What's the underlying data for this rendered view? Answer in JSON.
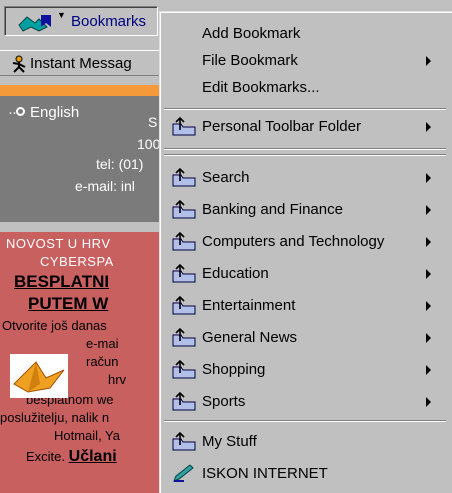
{
  "toolbar": {
    "bookmarks_label": "Bookmarks",
    "instant_messenger_label": "Instant Messag"
  },
  "page": {
    "language_label": "English",
    "contact": {
      "s_fragment": "S",
      "num_fragment": "100",
      "tel": "tel: (01)",
      "email": "e-mail: inl"
    },
    "promo": {
      "line1": "NOVOST U HRV",
      "line2": "CYBERSPA",
      "line3": "BESPLATNI",
      "line4": "PUTEM W",
      "line5": "Otvorite još danas",
      "line6": "e-mai",
      "line7": "račun",
      "line8": "hrv",
      "line9": "besplatnom we",
      "line10": "poslužitelju, nalik n",
      "line11": "Hotmail, Ya",
      "line12a": "Excite.",
      "line12b": "Učlani"
    }
  },
  "menu": {
    "top_items": [
      {
        "label": "Add Bookmark",
        "submenu": false
      },
      {
        "label": "File Bookmark",
        "submenu": true
      },
      {
        "label": "Edit Bookmarks...",
        "submenu": false
      }
    ],
    "toolbar_folder": {
      "label": "Personal Toolbar Folder",
      "submenu": true
    },
    "folders": [
      {
        "label": "Search",
        "submenu": true
      },
      {
        "label": "Banking and Finance",
        "submenu": true
      },
      {
        "label": "Computers and Technology",
        "submenu": true
      },
      {
        "label": "Education",
        "submenu": true
      },
      {
        "label": "Entertainment",
        "submenu": true
      },
      {
        "label": "General News",
        "submenu": true
      },
      {
        "label": "Shopping",
        "submenu": true
      },
      {
        "label": "Sports",
        "submenu": true
      }
    ],
    "bottom_items": [
      {
        "label": "My Stuff",
        "icon": "folder"
      },
      {
        "label": "ISKON INTERNET",
        "icon": "bookmark"
      }
    ]
  },
  "colors": {
    "link_blue": "#000080",
    "orange_band": "#f59a3a",
    "promo_red": "#c86060",
    "panel_gray": "#7b7b7b"
  }
}
